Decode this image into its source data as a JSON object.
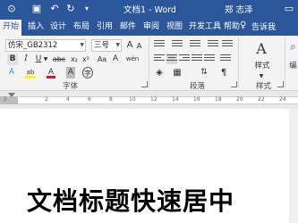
{
  "titlebar": {
    "title": "文档1 - Word",
    "user": "郑 志泽"
  },
  "tabs": [
    "开始",
    "插入",
    "设计",
    "布局",
    "引用",
    "邮件",
    "审阅",
    "视图",
    "开发工具",
    "帮助"
  ],
  "active_tab": "开始",
  "tell_me": "告诉我",
  "font": {
    "name": "仿宋_GB2312",
    "size": "三号",
    "grow": "A",
    "shrink": "A",
    "case": "Aa",
    "clear": "A",
    "wen": "wén",
    "bold": "B",
    "italic": "I",
    "underline": "U",
    "strike": "abc",
    "subscript": "x₂",
    "superscript": "x²",
    "effects": "A",
    "highlight": "ab",
    "color": "A",
    "char_shade": "A",
    "circle": "字",
    "group_label": "字体"
  },
  "paragraph": {
    "group_label": "段落"
  },
  "styles": {
    "icon": "A",
    "label": "样式",
    "group_label": "样式"
  },
  "editing": {
    "label": "编"
  },
  "ruler": {
    "numbers": [
      "2",
      "2",
      "4",
      "6",
      "8",
      "10",
      "12",
      "14",
      "16",
      "18",
      "20",
      "22",
      "24"
    ]
  },
  "document": {
    "heading": "文档标题快速居中"
  },
  "colors": {
    "brand": "#2b579a",
    "ribbon": "#f3f3f3",
    "highlight": "#ffff00",
    "font_color": "#e81123"
  }
}
